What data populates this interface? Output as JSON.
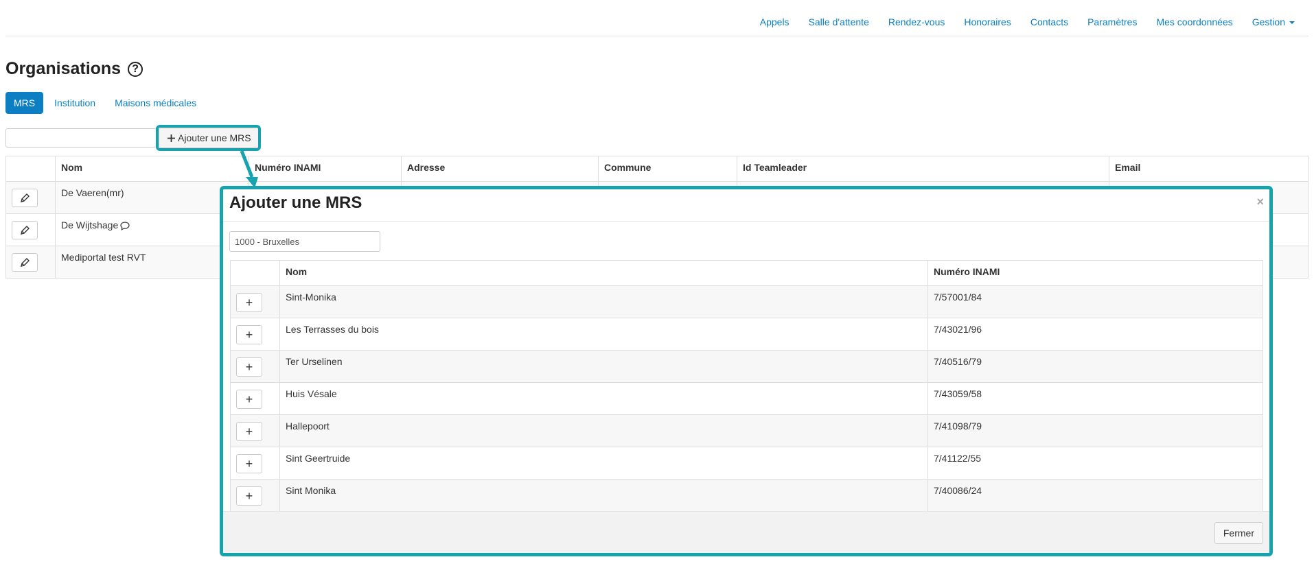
{
  "nav": {
    "items": [
      "Appels",
      "Salle d'attente",
      "Rendez-vous",
      "Honoraires",
      "Contacts",
      "Paramètres",
      "Mes coordonnées",
      "Gestion"
    ]
  },
  "page": {
    "title": "Organisations"
  },
  "tabs": [
    "MRS",
    "Institution",
    "Maisons médicales"
  ],
  "toolbar": {
    "search_value": "",
    "add_label": "Ajouter une MRS"
  },
  "table": {
    "columns": [
      "",
      "Nom",
      "Numéro INAMI",
      "Adresse",
      "Commune",
      "Id Teamleader",
      "Email"
    ],
    "rows": [
      {
        "nom": "De Vaeren(mr)"
      },
      {
        "nom": "De Wijtshage"
      },
      {
        "nom": "Mediportal test RVT"
      }
    ]
  },
  "modal": {
    "title": "Ajouter une MRS",
    "close_glyph": "×",
    "postal_value": "1000 - Bruxelles",
    "columns": [
      "",
      "Nom",
      "Numéro INAMI"
    ],
    "rows": [
      {
        "nom": "Sint-Monika",
        "inami": "7/57001/84"
      },
      {
        "nom": "Les Terrasses du bois",
        "inami": "7/43021/96"
      },
      {
        "nom": "Ter Urselinen",
        "inami": "7/40516/79"
      },
      {
        "nom": "Huis Vésale",
        "inami": "7/43059/58"
      },
      {
        "nom": "Hallepoort",
        "inami": "7/41098/79"
      },
      {
        "nom": "Sint Geertruide",
        "inami": "7/41122/55"
      },
      {
        "nom": "Sint Monika",
        "inami": "7/40086/24"
      }
    ],
    "add_glyph": "+",
    "footer_close_label": "Fermer"
  },
  "colors": {
    "link": "#0b7fc1",
    "highlight": "#16a3ad"
  }
}
